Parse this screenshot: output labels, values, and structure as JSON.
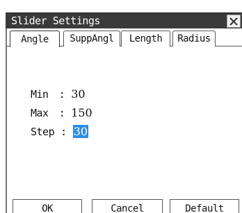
{
  "dialog": {
    "title": "Slider Settings",
    "close_glyph": "×"
  },
  "tabs": [
    {
      "label": "Angle",
      "active": true
    },
    {
      "label": "SuppAngl",
      "active": false
    },
    {
      "label": "Length",
      "active": false
    },
    {
      "label": "Radius",
      "active": false
    }
  ],
  "fields": {
    "min": {
      "label": "Min",
      "separator": ":",
      "value": "30"
    },
    "max": {
      "label": "Max",
      "separator": ":",
      "value": "150"
    },
    "step": {
      "label": "Step",
      "separator": ":",
      "value": "30",
      "selected": true
    }
  },
  "buttons": {
    "ok": "OK",
    "cancel": "Cancel",
    "default": "Default"
  },
  "colors": {
    "title_bar": "#3a3a3a",
    "selection": "#2f8de0"
  }
}
